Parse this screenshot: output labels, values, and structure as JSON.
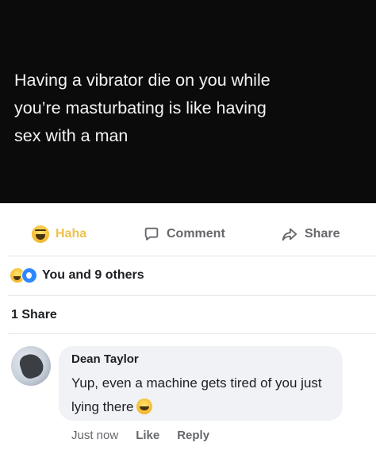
{
  "post": {
    "text": "Having a vibrator die on you while\nyou’re masturbating is like having\nsex with a man"
  },
  "actions": {
    "haha_label": "Haha",
    "comment_label": "Comment",
    "share_label": "Share"
  },
  "reactions": {
    "summary": "You and 9 others",
    "icons": [
      "haha-icon",
      "wow-icon"
    ]
  },
  "shares": {
    "count_text": "1 Share"
  },
  "comment": {
    "author": "Dean Taylor",
    "text": "Yup, even a machine gets tired of you just lying there",
    "emoji": "laughing-emoji-icon",
    "time": "Just now",
    "like_label": "Like",
    "reply_label": "Reply"
  },
  "colors": {
    "post_background": "#0b0b0b",
    "post_text": "#f2f2f2",
    "haha_accent": "#f0c14b",
    "muted_text": "#65676b",
    "bubble_background": "#f0f2f5"
  }
}
